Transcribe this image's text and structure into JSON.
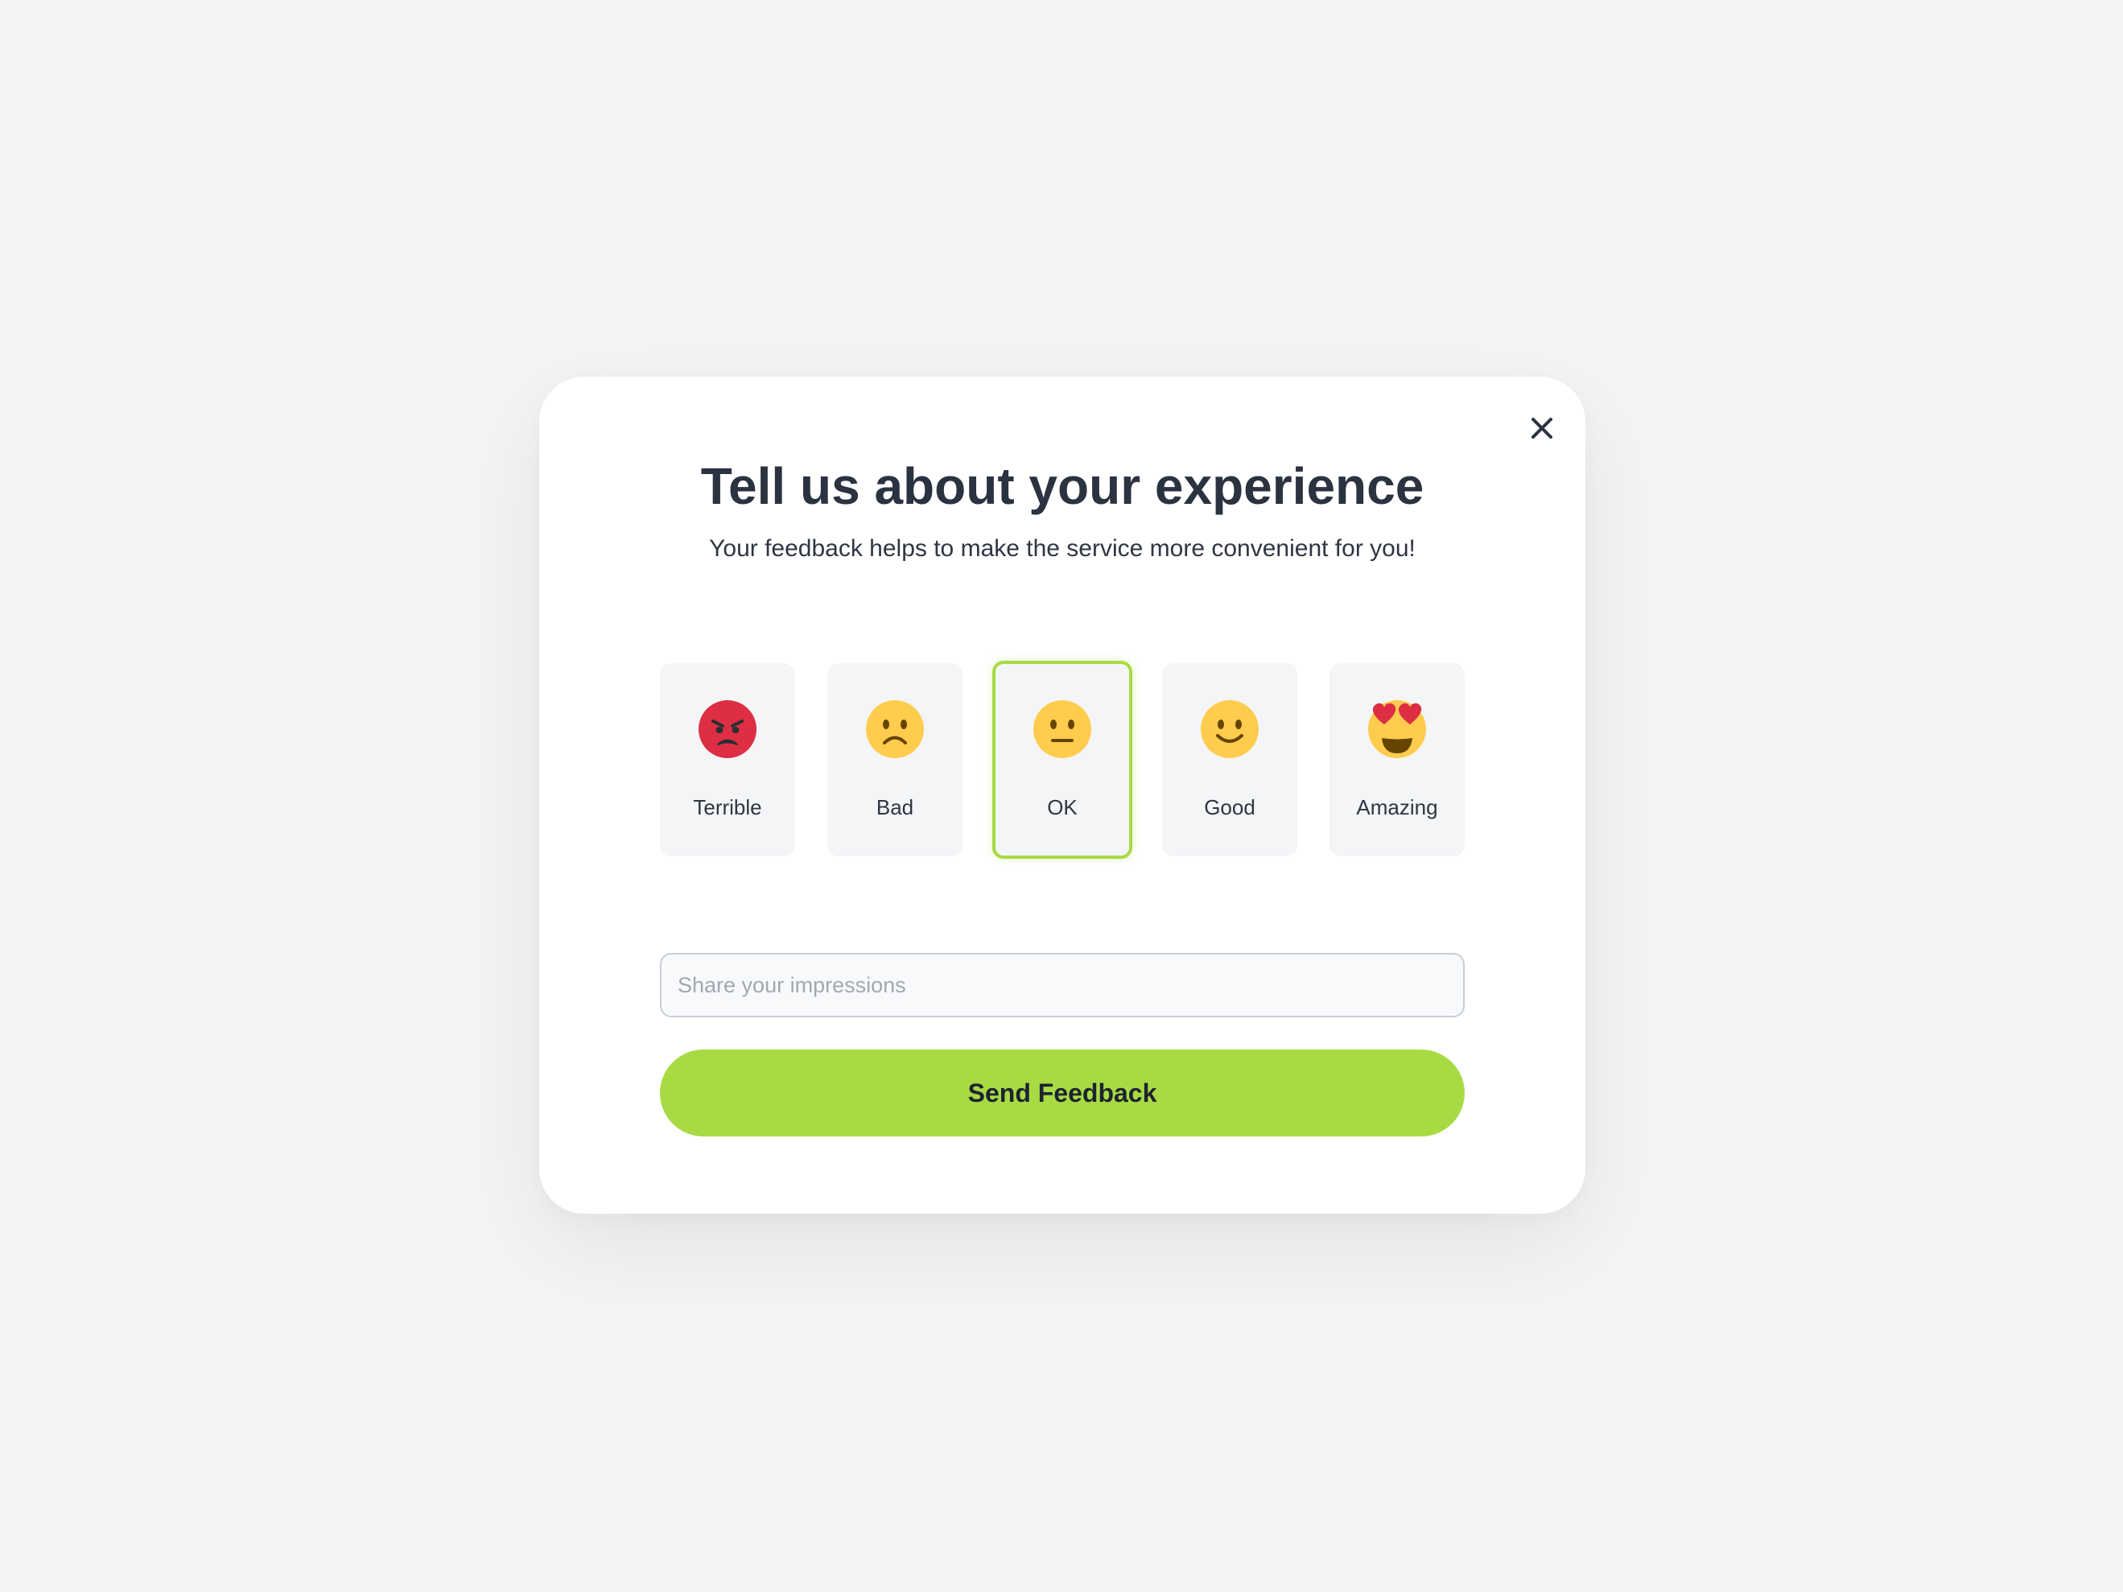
{
  "dialog": {
    "title": "Tell us about your experience",
    "subtitle": "Your feedback helps to make the service more convenient for you!",
    "close_icon": "close-icon"
  },
  "ratings": [
    {
      "label": "Terrible",
      "icon": "angry-face-icon",
      "color": "#dd2e44",
      "selected": false
    },
    {
      "label": "Bad",
      "icon": "frowning-face-icon",
      "color": "#ffcc4d",
      "selected": false
    },
    {
      "label": "OK",
      "icon": "neutral-face-icon",
      "color": "#ffcc4d",
      "selected": true
    },
    {
      "label": "Good",
      "icon": "smiling-face-icon",
      "color": "#ffcc4d",
      "selected": false
    },
    {
      "label": "Amazing",
      "icon": "heart-eyes-face-icon",
      "color": "#ffcc4d",
      "selected": false
    }
  ],
  "input": {
    "placeholder": "Share your impressions",
    "value": ""
  },
  "submit": {
    "label": "Send Feedback"
  },
  "colors": {
    "accent": "#a8db43",
    "selected_border": "#a7da43",
    "heading": "#2b3240",
    "background": "#f4f4f4"
  }
}
